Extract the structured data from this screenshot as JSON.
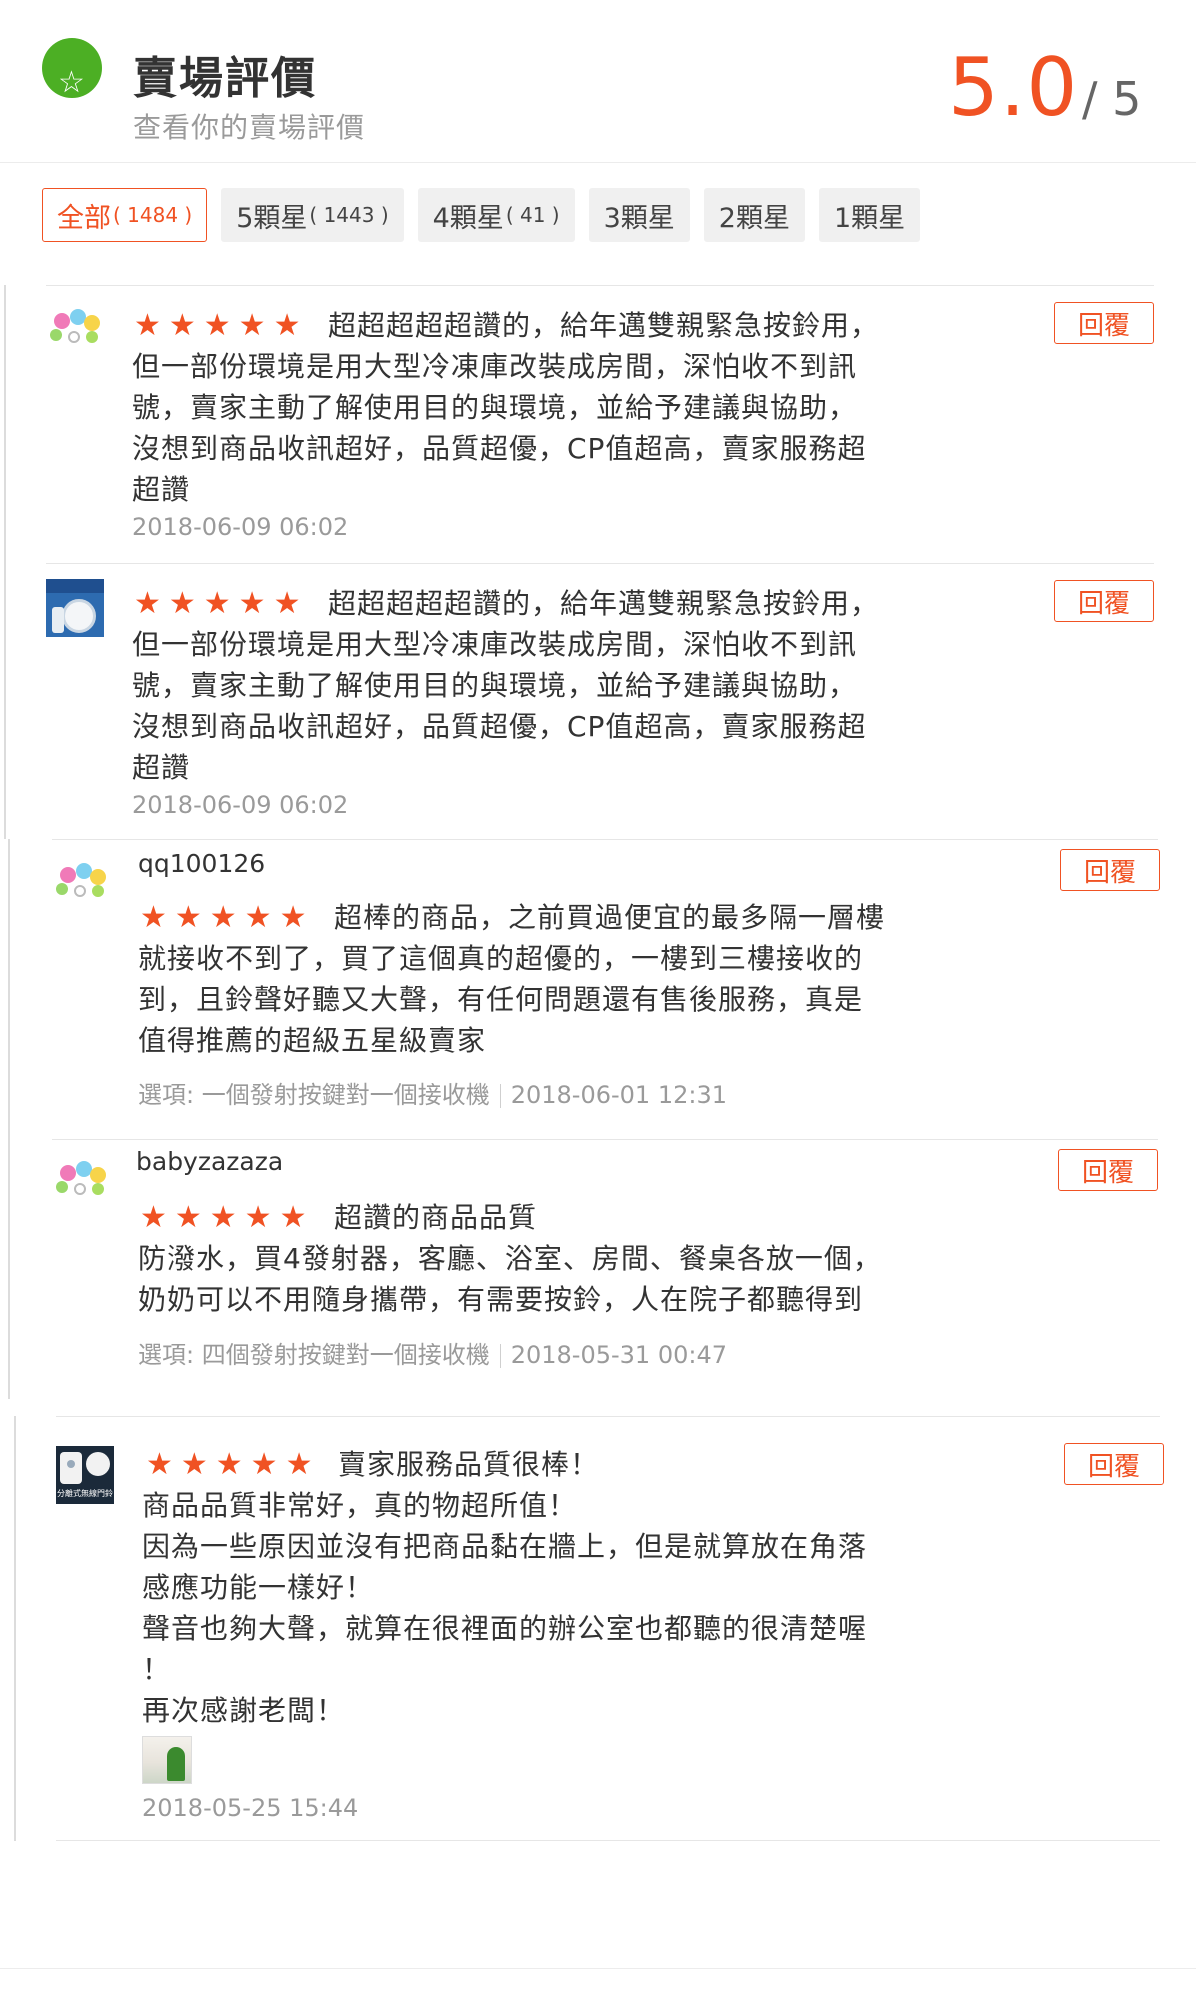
{
  "header": {
    "title": "賣場評價",
    "subtitle": "查看你的賣場評價",
    "rating": "5.0",
    "rating_total": "/ 5",
    "colors": {
      "accent": "#f05223",
      "logo": "#4caf24"
    }
  },
  "filters": [
    {
      "label": "全部",
      "count": "( 1484 )"
    },
    {
      "label": "5顆星",
      "count": "( 1443 )"
    },
    {
      "label": "4顆星",
      "count": "( 41 )"
    },
    {
      "label": "3顆星",
      "count": ""
    },
    {
      "label": "2顆星",
      "count": ""
    },
    {
      "label": "1顆星",
      "count": ""
    }
  ],
  "reviews": [
    {
      "username": "",
      "stars": "★★★★★",
      "comment": "超超超超超讚的，給年邁雙親緊急按鈴用，\n但一部份環境是用大型冷凍庫改裝成房間，深怕收不到訊\n號，賣家主動了解使用目的與環境，並給予建議與協助，\n沒想到商品收訊超好，品質超優，CP值超高，賣家服務超\n超讚",
      "option": "",
      "date": "2018-06-09 06:02",
      "reply": "回覆"
    },
    {
      "username": "",
      "stars": "★★★★★",
      "comment": "超超超超超讚的，給年邁雙親緊急按鈴用，\n但一部份環境是用大型冷凍庫改裝成房間，深怕收不到訊\n號，賣家主動了解使用目的與環境，並給予建議與協助，\n沒想到商品收訊超好，品質超優，CP值超高，賣家服務超\n超讚",
      "option": "",
      "date": "2018-06-09 06:02",
      "reply": "回覆"
    },
    {
      "username": "qq100126",
      "stars": "★★★★★",
      "comment": "超棒的商品，之前買過便宜的最多隔一層樓\n就接收不到了，買了這個真的超優的，一樓到三樓接收的\n到，且鈴聲好聽又大聲，有任何問題還有售後服務，真是\n值得推薦的超級五星級賣家",
      "option": "選項: 一個發射按鍵對一個接收機",
      "date": "2018-06-01 12:31",
      "reply": "回覆"
    },
    {
      "username": "babyzazaza",
      "stars": "★★★★★",
      "comment": "超讚的商品品質\n防潑水，買4發射器，客廳、浴室、房間、餐桌各放一個，\n奶奶可以不用隨身攜帶，有需要按鈴，人在院子都聽得到",
      "option": "選項: 四個發射按鍵對一個接收機",
      "date": "2018-05-31 00:47",
      "reply": "回覆"
    },
    {
      "username": "",
      "stars": "★★★★★",
      "comment": "賣家服務品質很棒！\n商品品質非常好，真的物超所值！\n因為一些原因並沒有把商品黏在牆上，但是就算放在角落\n感應功能一樣好！\n聲音也夠大聲，就算在很裡面的辦公室也都聽的很清楚喔\n！\n再次感謝老闆！",
      "option": "",
      "date": "2018-05-25 15:44",
      "reply": "回覆"
    }
  ],
  "avatars": {
    "product_image_text": "分離式無線門鈴"
  }
}
